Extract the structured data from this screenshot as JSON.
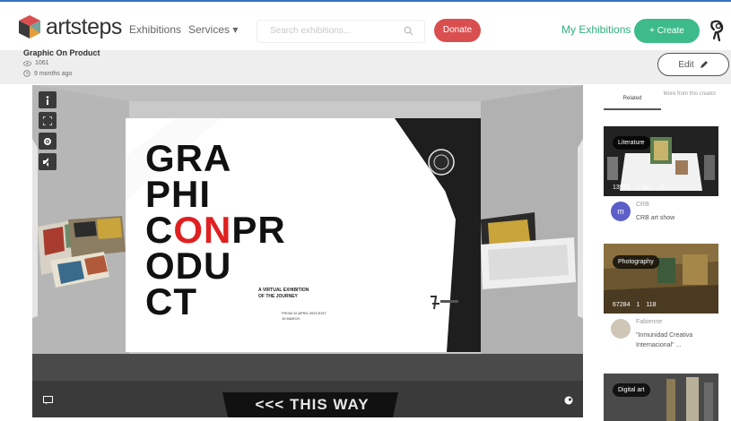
{
  "header": {
    "logo_text": "artsteps",
    "nav": {
      "exhibitions": "Exhibitions",
      "services": "Services ▾"
    },
    "search_placeholder": "Search exhibitions...",
    "donate_label": "Donate",
    "my_exhibitions": "My Exhibitions",
    "create_label": "+ Create",
    "colors": {
      "accent_green": "#3dbb8b",
      "donate_red": "#d94f4f"
    }
  },
  "exhibition": {
    "title": "Graphic On Product",
    "views": "1061",
    "age": "9 months ago",
    "edit_label": "Edit"
  },
  "viewer": {
    "poster": {
      "line1": "GRA",
      "line2": "PHI",
      "line3a": "C",
      "line3b": "ON",
      "line3c": "PR",
      "line4": "ODU",
      "line5": "CT",
      "subtitle": "A VIRTUAL EXHIBITION OF THE JOURNEY",
      "dates": "FROM 10 APRIL 2023 EXIT 10 MARCH"
    },
    "floor_sign": "<<< THIS WAY",
    "tools": [
      "info-icon",
      "fullscreen-icon",
      "settings-icon",
      "mute-icon"
    ]
  },
  "sidebar": {
    "tabs": [
      {
        "label": "Related"
      },
      {
        "label": "More from this creator"
      }
    ],
    "cards": [
      {
        "category": "Literature",
        "views": "13976",
        "time": "1 da...",
        "likes": "6",
        "author": "CRB",
        "title": "CRB art show"
      },
      {
        "category": "Photography",
        "views": "67284",
        "time": "1",
        "likes": "118",
        "author": "Fabienne",
        "title": "\"Inmunidad Creativa Internacional\" ..."
      },
      {
        "category": "Digital art"
      }
    ]
  }
}
